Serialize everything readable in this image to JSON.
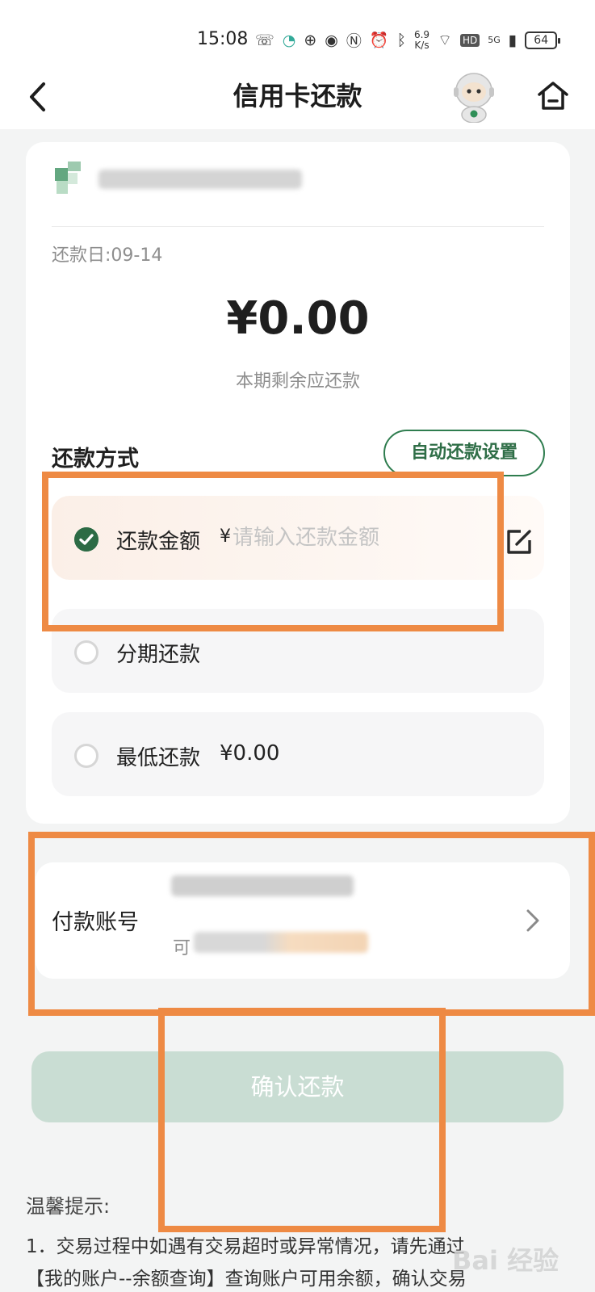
{
  "status_bar": {
    "time": "15:08",
    "net_speed_value": "6.9",
    "net_speed_unit": "K/s",
    "hd": "HD",
    "network": "5G",
    "battery": "64"
  },
  "header": {
    "title": "信用卡还款",
    "back_icon": "chevron-left-icon",
    "home_icon": "home-icon",
    "mascot_icon": "astronaut-mascot-icon"
  },
  "card": {
    "due_date": "还款日:09-14",
    "balance": "¥0.00",
    "balance_label": "本期剩余应还款"
  },
  "repay_method": {
    "title": "还款方式",
    "auto_button": "自动还款设置",
    "options": [
      {
        "label": "还款金额",
        "currency": "¥",
        "placeholder": "请输入还款金额",
        "selected": true
      },
      {
        "label": "分期还款",
        "selected": false
      },
      {
        "label": "最低还款",
        "amount": "¥0.00",
        "selected": false
      }
    ]
  },
  "account": {
    "label": "付款账号",
    "available_prefix": "可"
  },
  "confirm_button": "确认还款",
  "tips": {
    "title": "温馨提示:",
    "lines": [
      "1．交易过程中如遇有交易超时或异常情况，请先通过",
      "【我的账户--余额查询】查询账户可用余额，确认交易"
    ]
  },
  "watermark": "Bai 经验",
  "colors": {
    "accent_green": "#2c6b45",
    "confirm_disabled": "#c9ddd3",
    "highlight_orange": "#ee8a44"
  }
}
